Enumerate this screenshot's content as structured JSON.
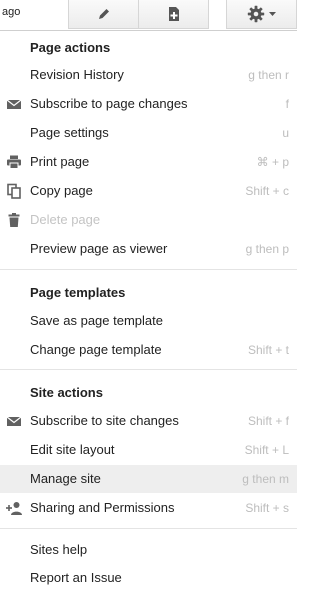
{
  "header": {
    "ago_text": "ago",
    "buttons": [
      {
        "icon": "pencil-icon"
      },
      {
        "icon": "new-page-icon"
      },
      {
        "icon": "gear-icon"
      }
    ]
  },
  "page_actions": {
    "title": "Page actions",
    "items": [
      {
        "label": "Revision History",
        "shortcut": "g then r",
        "icon": ""
      },
      {
        "label": "Subscribe to page changes",
        "shortcut": "f",
        "icon": "envelope-icon"
      },
      {
        "label": "Page settings",
        "shortcut": "u",
        "icon": ""
      },
      {
        "label": "Print page",
        "shortcut": "⌘ + p",
        "icon": "printer-icon"
      },
      {
        "label": "Copy page",
        "shortcut": "Shift + c",
        "icon": "copy-icon"
      },
      {
        "label": "Delete page",
        "shortcut": "",
        "icon": "trash-icon",
        "disabled": true
      },
      {
        "label": "Preview page as viewer",
        "shortcut": "g then p",
        "icon": ""
      }
    ]
  },
  "page_templates": {
    "title": "Page templates",
    "items": [
      {
        "label": "Save as page template",
        "shortcut": ""
      },
      {
        "label": "Change page template",
        "shortcut": "Shift + t"
      }
    ]
  },
  "site_actions": {
    "title": "Site actions",
    "items": [
      {
        "label": "Subscribe to site changes",
        "shortcut": "Shift + f",
        "icon": "envelope-icon"
      },
      {
        "label": "Edit site layout",
        "shortcut": "Shift + L",
        "icon": ""
      },
      {
        "label": "Manage site",
        "shortcut": "g then m",
        "icon": "",
        "highlighted": true
      },
      {
        "label": "Sharing and Permissions",
        "shortcut": "Shift + s",
        "icon": "add-person-icon"
      }
    ]
  },
  "help": {
    "items": [
      {
        "label": "Sites help"
      },
      {
        "label": "Report an Issue"
      }
    ]
  }
}
